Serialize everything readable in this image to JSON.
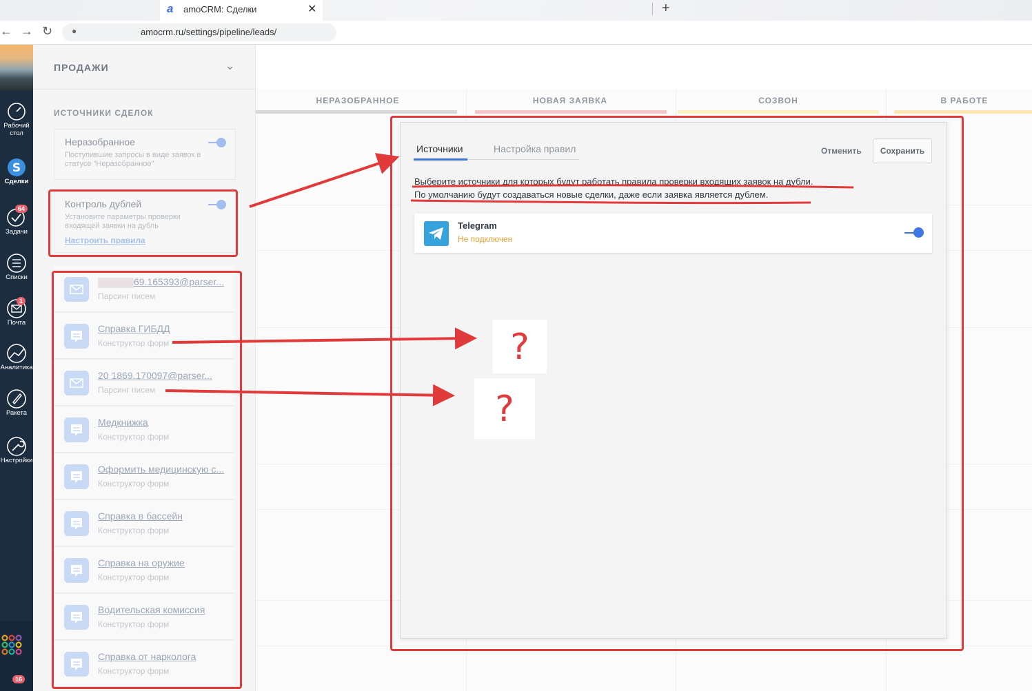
{
  "browser": {
    "tab_title": "amoCRM: Сделки",
    "tab_favicon": "a",
    "url": "amocrm.ru/settings/pipeline/leads/",
    "new_tab_symbol": "+",
    "close_symbol": "✕"
  },
  "nav": {
    "items": [
      {
        "icon": "dashboard-icon",
        "label_line1": "Рабочий",
        "label_line2": "стол"
      },
      {
        "icon": "deals-icon",
        "label_line1": "Сделки",
        "label_line2": ""
      },
      {
        "icon": "tasks-icon",
        "label_line1": "Задачи",
        "label_line2": "",
        "badge": "64"
      },
      {
        "icon": "lists-icon",
        "label_line1": "Списки",
        "label_line2": ""
      },
      {
        "icon": "mail-icon",
        "label_line1": "Почта",
        "label_line2": "",
        "badge": "1"
      },
      {
        "icon": "analytics-icon",
        "label_line1": "Аналитика",
        "label_line2": ""
      },
      {
        "icon": "rocket-icon",
        "label_line1": "Ракета",
        "label_line2": ""
      },
      {
        "icon": "settings-icon",
        "label_line1": "Настройки",
        "label_line2": ""
      }
    ],
    "bottom_badge": "16",
    "active_color": "#3a8fe0"
  },
  "settings": {
    "pipeline_name": "ПРОДАЖИ",
    "sources_title": "ИСТОЧНИКИ СДЕЛОК",
    "unsorted": {
      "title": "Неразобранное",
      "description": "Поступившие запросы в виде заявок в статусе \"Неразобранное\""
    },
    "duplicates": {
      "title": "Контроль дублей",
      "description": "Установите параметры проверки входящей заявки на дубль",
      "link": "Настроить правила"
    },
    "sources": [
      {
        "name": "69.165393@parser...",
        "type": "Парсинг писем",
        "icon": "envelope-icon",
        "redacted_prefix": true
      },
      {
        "name": "Справка ГИБДД",
        "type": "Конструктор форм",
        "icon": "form-icon"
      },
      {
        "name": "20 1869.170097@parser...",
        "type": "Парсинг писем",
        "icon": "envelope-icon"
      },
      {
        "name": "Медкнижка",
        "type": "Конструктор форм",
        "icon": "form-icon"
      },
      {
        "name": "Оформить медицинскую с...",
        "type": "Конструктор форм",
        "icon": "form-icon"
      },
      {
        "name": "Справка в бассейн",
        "type": "Конструктор форм",
        "icon": "form-icon"
      },
      {
        "name": "Справка на оружие",
        "type": "Конструктор форм",
        "icon": "form-icon"
      },
      {
        "name": "Водительская комиссия",
        "type": "Конструктор форм",
        "icon": "form-icon"
      },
      {
        "name": "Справка от нарколога",
        "type": "Конструктор форм",
        "icon": "form-icon"
      }
    ]
  },
  "board": {
    "columns": [
      {
        "title": "НЕРАЗОБРАННОЕ",
        "color": "#d8d8d8"
      },
      {
        "title": "НОВАЯ ЗАЯВКА",
        "color": "#f4c6c9"
      },
      {
        "title": "СОЗВОН",
        "color": "#fbf2c4"
      },
      {
        "title": "В РАБОТЕ",
        "color": "#fde8b3"
      }
    ]
  },
  "modal": {
    "tab_sources": "Источники",
    "tab_rules": "Настройка правил",
    "cancel": "Отменить",
    "save": "Сохранить",
    "description_line1": "Выберите источники для которых будут работать правила проверки входящих заявок на дубли.",
    "description_line2": "По умолчанию будут создаваться новые сделки, даже если заявка является дублем.",
    "telegram": {
      "name": "Telegram",
      "status": "Не подключен",
      "icon": "telegram-icon"
    }
  },
  "annotations": {
    "question_marks": [
      "?",
      "?"
    ],
    "color": "#e03a3a"
  }
}
